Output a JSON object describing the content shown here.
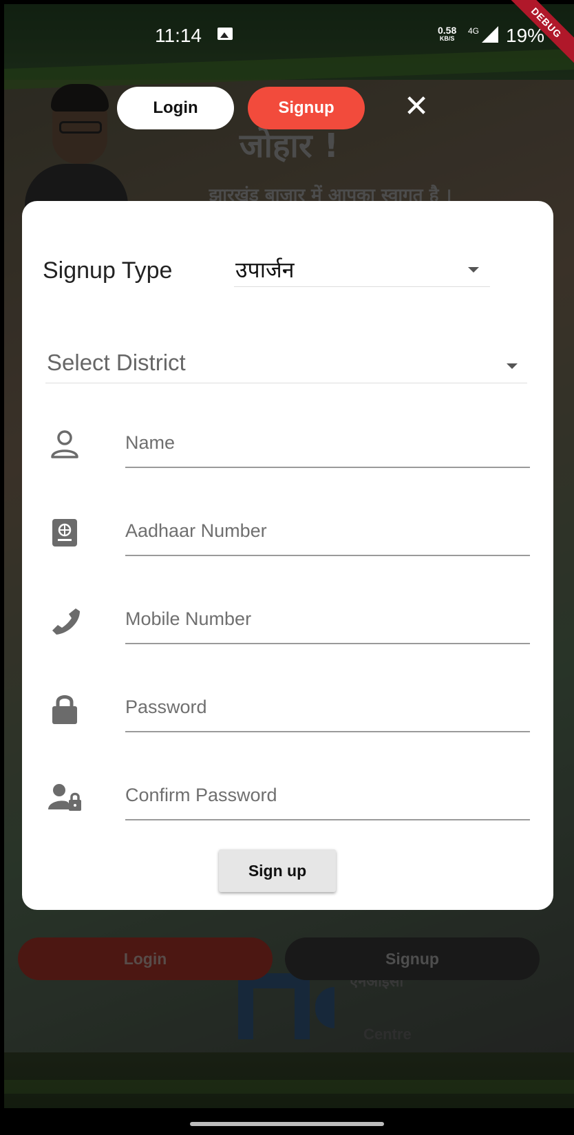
{
  "status_bar": {
    "time": "11:14",
    "net_speed": "0.58",
    "net_speed_unit": "KB/S",
    "network_type": "4G",
    "battery": "19%",
    "debug_label": "DEBUG"
  },
  "background": {
    "greeting": "जोहार !",
    "welcome": "झारखंड बाजार में आपका स्वागत है ।",
    "nic_text_top": "एनआईसी",
    "nic_text_bottom": "Centre",
    "bottom_login_label": "Login",
    "bottom_signup_label": "Signup"
  },
  "top_tabs": {
    "login_label": "Login",
    "signup_label": "Signup",
    "close_symbol": "✕"
  },
  "form": {
    "signup_type_label": "Signup Type",
    "signup_type_value": "उपार्जन",
    "district_placeholder": "Select District",
    "fields": [
      {
        "placeholder": "Name",
        "icon": "person-outline-icon"
      },
      {
        "placeholder": "Aadhaar Number",
        "icon": "id-card-icon"
      },
      {
        "placeholder": "Mobile Number",
        "icon": "phone-icon"
      },
      {
        "placeholder": "Password",
        "icon": "lock-icon"
      },
      {
        "placeholder": "Confirm Password",
        "icon": "person-lock-icon"
      }
    ],
    "submit_label": "Sign up"
  },
  "colors": {
    "accent_red": "#f24b3c",
    "card_bg": "#ffffff"
  }
}
